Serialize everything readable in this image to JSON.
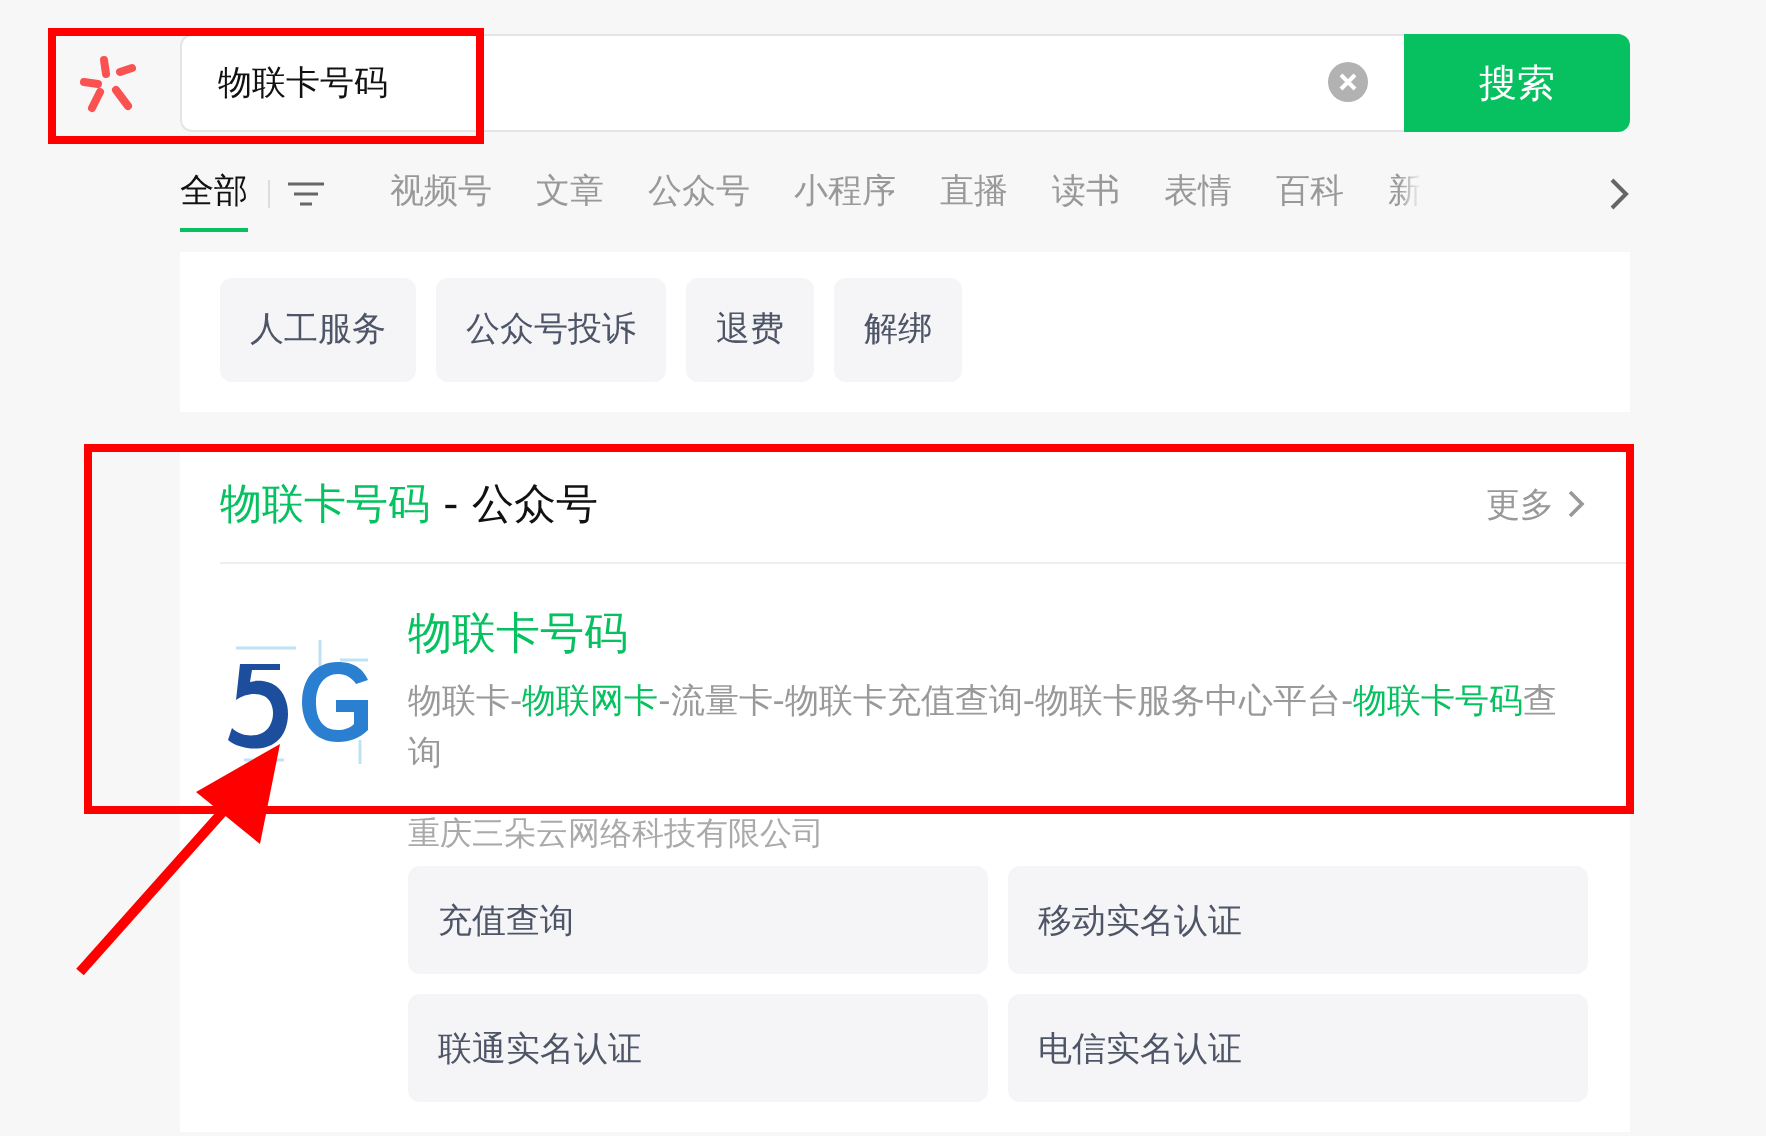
{
  "search": {
    "value": "物联卡号码",
    "button": "搜索"
  },
  "tabs": [
    {
      "label": "全部",
      "selected": true
    },
    {
      "label": "视频号",
      "selected": false
    },
    {
      "label": "文章",
      "selected": false
    },
    {
      "label": "公众号",
      "selected": false
    },
    {
      "label": "小程序",
      "selected": false
    },
    {
      "label": "直播",
      "selected": false
    },
    {
      "label": "读书",
      "selected": false
    },
    {
      "label": "表情",
      "selected": false
    },
    {
      "label": "百科",
      "selected": false
    },
    {
      "label": "新",
      "selected": false
    }
  ],
  "quick_links": [
    "人工服务",
    "公众号投诉",
    "退费",
    "解绑"
  ],
  "section": {
    "heading": [
      {
        "text": "物联卡号码",
        "highlight": true
      },
      {
        "text": " - 公众号",
        "highlight": false
      }
    ],
    "more": "更多",
    "result": {
      "title": "物联卡号码",
      "description": [
        {
          "text": "物联卡-",
          "highlight": false
        },
        {
          "text": "物联网卡",
          "highlight": true
        },
        {
          "text": "-流量卡-物联卡充值查询-物联卡服务中心平台-",
          "highlight": false
        },
        {
          "text": "物联卡号码",
          "highlight": true
        },
        {
          "text": "查询",
          "highlight": false
        }
      ],
      "company": "重庆三朵云网络科技有限公司",
      "menu": [
        "充值查询",
        "移动实名认证",
        "联通实名认证",
        "电信实名认证"
      ]
    }
  }
}
